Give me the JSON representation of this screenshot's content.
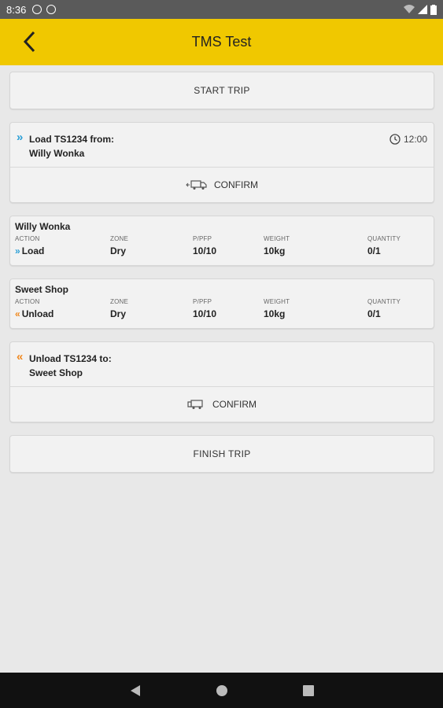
{
  "status_bar": {
    "time": "8:36"
  },
  "app_bar": {
    "title": "TMS Test"
  },
  "start_trip": {
    "label": "START TRIP"
  },
  "load_task": {
    "line1": "Load TS1234 from:",
    "line2": "Willy Wonka",
    "time": "12:00",
    "confirm_label": "CONFIRM"
  },
  "stops": [
    {
      "name": "Willy Wonka",
      "headers": [
        "ACTION",
        "ZONE",
        "P/PFP",
        "WEIGHT",
        "QUANTITY"
      ],
      "action": "Load",
      "zone": "Dry",
      "ppfp": "10/10",
      "weight": "10kg",
      "quantity": "0/1"
    },
    {
      "name": "Sweet Shop",
      "headers": [
        "ACTION",
        "ZONE",
        "P/PFP",
        "WEIGHT",
        "QUANTITY"
      ],
      "action": "Unload",
      "zone": "Dry",
      "ppfp": "10/10",
      "weight": "10kg",
      "quantity": "0/1"
    }
  ],
  "unload_task": {
    "line1": "Unload TS1234 to:",
    "line2": "Sweet Shop",
    "confirm_label": "CONFIRM"
  },
  "finish_trip": {
    "label": "FINISH TRIP"
  },
  "colors": {
    "app_bar": "#f0c800",
    "load_chevron": "#2a9fd6",
    "unload_chevron": "#f0881e",
    "background": "#e8e8e8"
  }
}
